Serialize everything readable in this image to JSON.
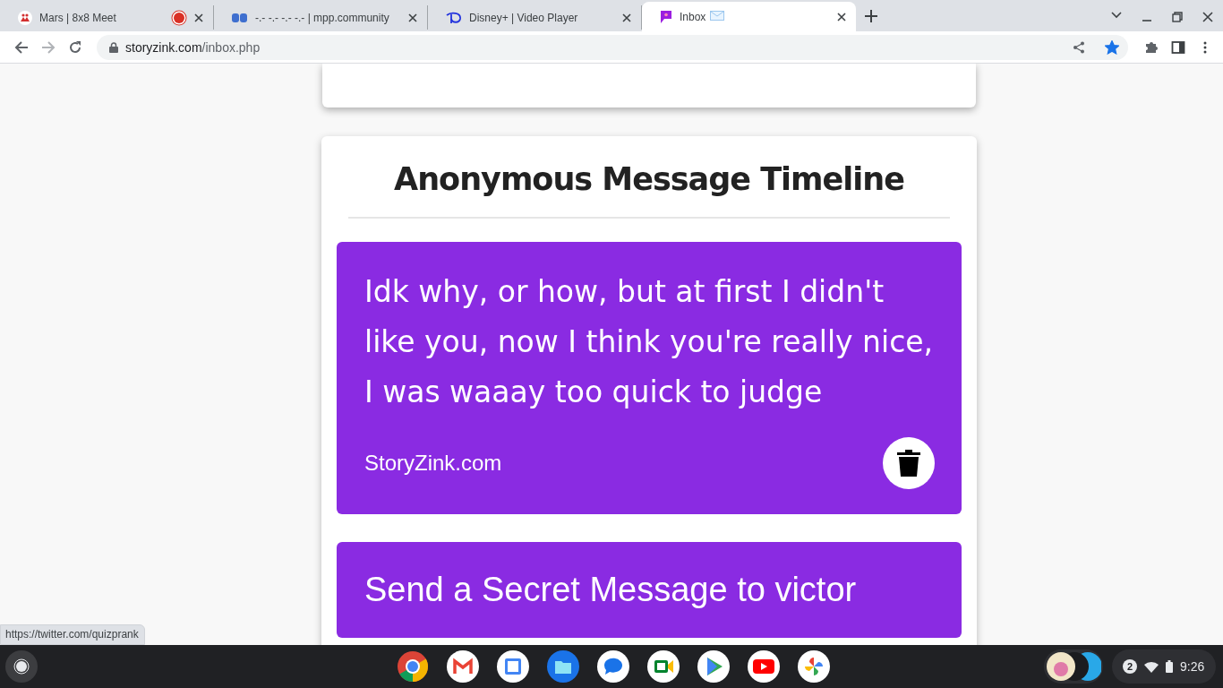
{
  "tabs": [
    {
      "title": "Mars | 8x8 Meet",
      "kind": "meet",
      "recording": true,
      "selected": false
    },
    {
      "title": "-.- -.- -.- -.- | mpp.community",
      "kind": "mpp",
      "recording": false,
      "selected": false
    },
    {
      "title": "Disney+ | Video Player",
      "kind": "disney",
      "recording": false,
      "selected": false
    },
    {
      "title": "Inbox",
      "kind": "inbox",
      "recording": false,
      "selected": true
    }
  ],
  "address": {
    "domain": "storyzink.com",
    "path": "/inbox.php",
    "bookmarked": true
  },
  "page": {
    "heading": "Anonymous Message Timeline",
    "messages": [
      {
        "text": "Idk why, or how, but at first I didn't like you, now I think you're really nice, I was waaay too quick to judge",
        "footer": "StoryZink.com"
      }
    ],
    "next_card": "Send a Secret Message to victor"
  },
  "status_url": "https://twitter.com/quizprank",
  "shelf": {
    "notification_count": "2",
    "time": "9:26"
  }
}
